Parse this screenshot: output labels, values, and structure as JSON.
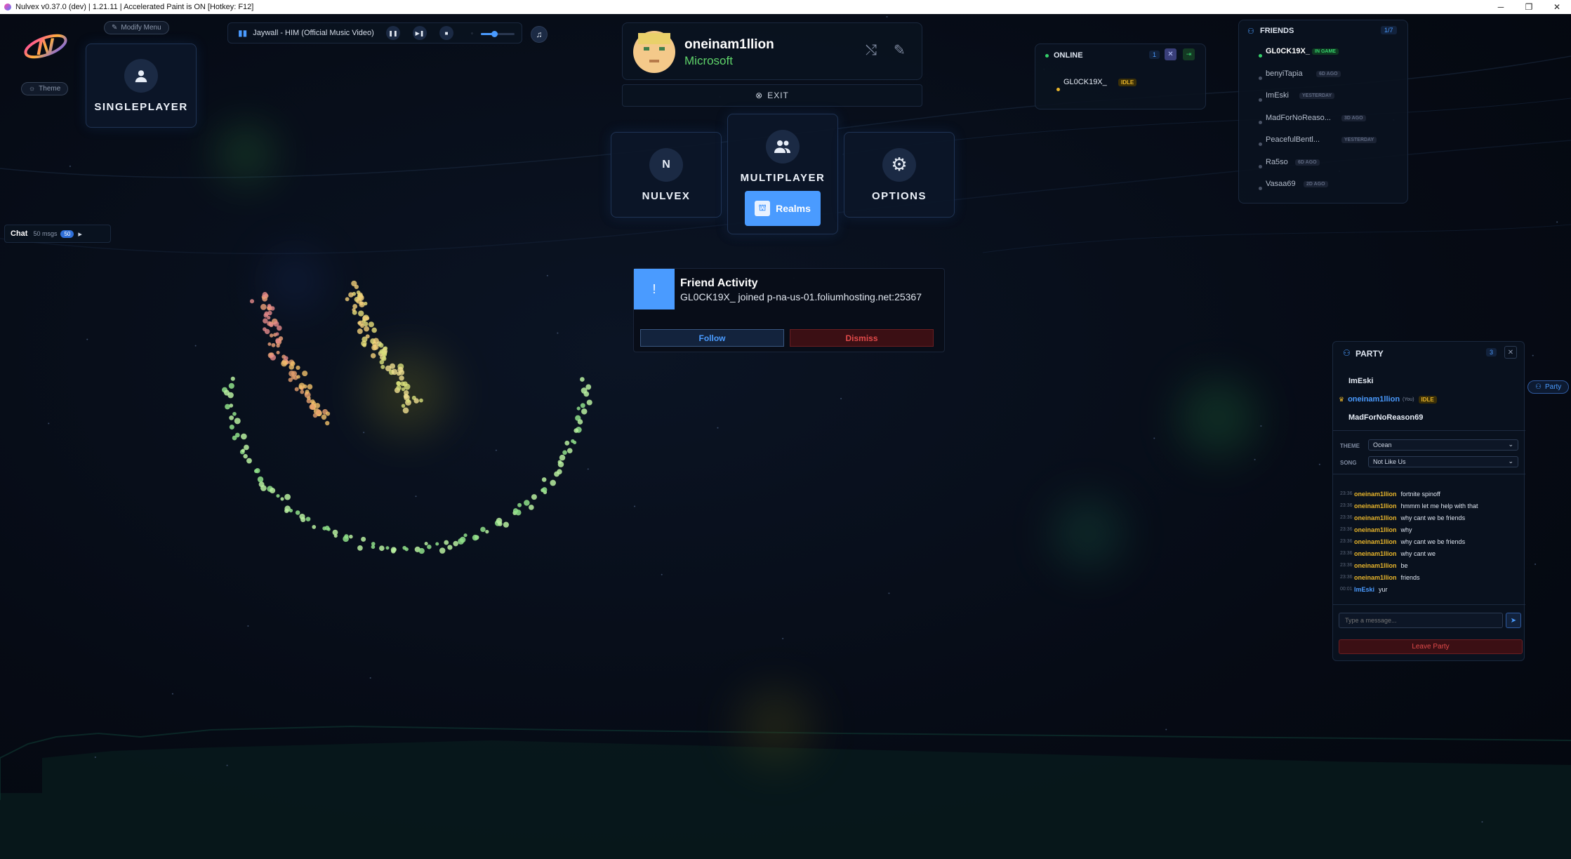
{
  "window": {
    "title": "Nulvex v0.37.0 (dev) | 1.21.11 | Accelerated Paint is ON [Hotkey: F12]",
    "minimize": "─",
    "restore": "❐",
    "close": "✕"
  },
  "top_left": {
    "modify_menu": "Modify Menu",
    "theme": "Theme",
    "singleplayer": "SINGLEPLAYER"
  },
  "music": {
    "track": "Jaywall - HIM (Official Music Video)",
    "volume_percent": 40
  },
  "profile": {
    "username": "oneinam1llion",
    "account_type": "Microsoft",
    "exit": "EXIT"
  },
  "menu": {
    "nulvex": "NULVEX",
    "nulvex_letter": "N",
    "multiplayer": "MULTIPLAYER",
    "realms": "Realms",
    "options": "OPTIONS"
  },
  "chat_toggle": {
    "label": "Chat",
    "msgs": "50 msgs",
    "count": "50",
    "arrow": "▸"
  },
  "notification": {
    "badge": "!",
    "title": "Friend Activity",
    "message": "GL0CK19X_ joined p-na-us-01.foliumhosting.net:25367",
    "follow": "Follow",
    "dismiss": "Dismiss"
  },
  "online": {
    "title": "ONLINE",
    "count": "1",
    "user": "GL0CK19X_",
    "status": "IDLE"
  },
  "friends": {
    "title": "FRIENDS",
    "count": "1/7",
    "list": [
      {
        "name": "GL0CK19X_",
        "status": "IN GAME",
        "online": true
      },
      {
        "name": "benyiTapia",
        "status": "6D AGO",
        "online": false
      },
      {
        "name": "ImEski",
        "status": "YESTERDAY",
        "online": false
      },
      {
        "name": "MadForNoReaso...",
        "status": "3D AGO",
        "online": false
      },
      {
        "name": "PeacefulBentl...",
        "status": "YESTERDAY",
        "online": false
      },
      {
        "name": "Ra5so",
        "status": "6D AGO",
        "online": false
      },
      {
        "name": "Vasaa69",
        "status": "2D AGO",
        "online": false
      }
    ]
  },
  "party": {
    "title": "PARTY",
    "count": "3",
    "side_button": "Party",
    "members": [
      {
        "name": "ImEski",
        "you": "",
        "tag": ""
      },
      {
        "name": "oneinam1llion",
        "you": "(You)",
        "tag": "IDLE"
      },
      {
        "name": "MadForNoReason69",
        "you": "",
        "tag": ""
      }
    ],
    "theme_label": "THEME",
    "theme_value": "Ocean",
    "song_label": "SONG",
    "song_value": "Not Like Us",
    "messages": [
      {
        "time": "23:36",
        "user": "oneinam1llion",
        "text": "fortnite spinoff"
      },
      {
        "time": "23:36",
        "user": "oneinam1llion",
        "text": "hmmm let me help with that"
      },
      {
        "time": "23:36",
        "user": "oneinam1llion",
        "text": "why cant we be friends"
      },
      {
        "time": "23:36",
        "user": "oneinam1llion",
        "text": "why"
      },
      {
        "time": "23:36",
        "user": "oneinam1llion",
        "text": "why cant we be friends"
      },
      {
        "time": "23:36",
        "user": "oneinam1llion",
        "text": "why cant we"
      },
      {
        "time": "23:36",
        "user": "oneinam1llion",
        "text": "be"
      },
      {
        "time": "23:36",
        "user": "oneinam1llion",
        "text": "friends"
      },
      {
        "time": "00:01",
        "user": "ImEski",
        "text": "yur"
      }
    ],
    "input_placeholder": "Type a message...",
    "leave": "Leave Party"
  },
  "colors": {
    "accent": "#4a9bff",
    "microsoft_green": "#5fd36a",
    "gold": "#e8b52b",
    "online_green": "#35d06a",
    "danger": "#d13a3a"
  }
}
